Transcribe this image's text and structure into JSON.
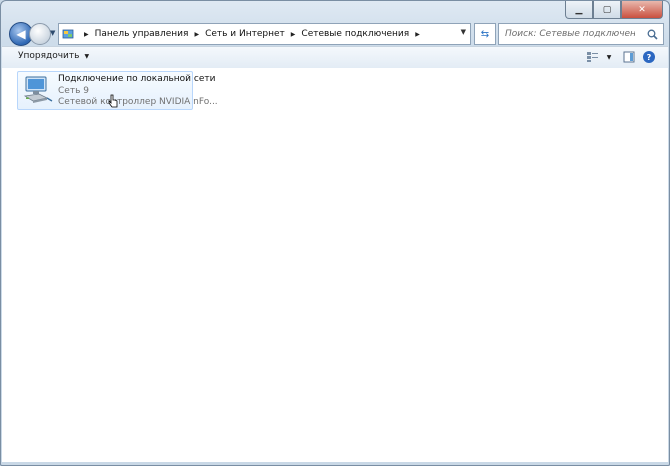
{
  "window": {
    "caption_icons": [
      "minimize-icon",
      "maximize-icon",
      "close-icon"
    ]
  },
  "navigation": {
    "back_icon": "back-arrow-icon",
    "forward_icon": "forward-arrow-icon"
  },
  "address_bar": {
    "icon": "control-panel-icon",
    "breadcrumbs": [
      "Панель управления",
      "Сеть и Интернет",
      "Сетевые подключения"
    ]
  },
  "search": {
    "placeholder": "Поиск: Сетевые подключения"
  },
  "toolbar": {
    "organize_label": "Упорядочить"
  },
  "connections": [
    {
      "name": "Подключение по локальной сети",
      "network": "Сеть  9",
      "adapter": "Сетевой контроллер NVIDIA nFo...",
      "icon": "network-adapter-icon"
    }
  ],
  "colors": {
    "accent": "#2b67c1",
    "selection_border": "#b8d6fb"
  }
}
